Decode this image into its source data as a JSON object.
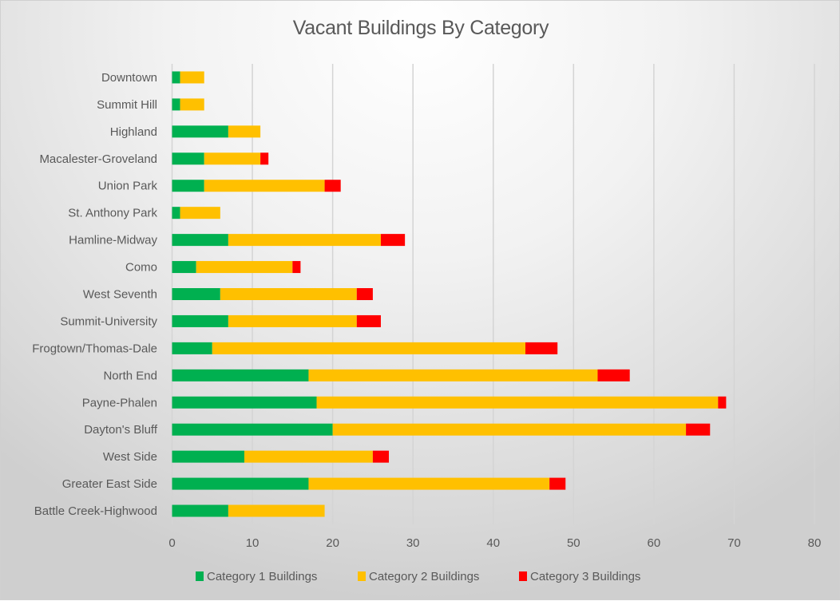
{
  "chart_data": {
    "type": "bar",
    "orientation": "horizontal",
    "stacked": true,
    "title": "Vacant Buildings By Category",
    "xlabel": "",
    "ylabel": "",
    "xlim": [
      0,
      80
    ],
    "xticks": [
      0,
      10,
      20,
      30,
      40,
      50,
      60,
      70,
      80
    ],
    "grid": true,
    "legend_position": "bottom",
    "categories": [
      "Downtown",
      "Summit Hill",
      "Highland",
      "Macalester-Groveland",
      "Union Park",
      "St. Anthony Park",
      "Hamline-Midway",
      "Como",
      "West Seventh",
      "Summit-University",
      "Frogtown/Thomas-Dale",
      "North End",
      "Payne-Phalen",
      "Dayton's Bluff",
      "West Side",
      "Greater East Side",
      "Battle Creek-Highwood"
    ],
    "series": [
      {
        "name": "Category 1 Buildings",
        "color": "#00b050",
        "values": [
          1,
          1,
          7,
          4,
          4,
          1,
          7,
          3,
          6,
          7,
          5,
          17,
          18,
          20,
          9,
          17,
          7
        ]
      },
      {
        "name": "Category 2 Buildings",
        "color": "#ffc000",
        "values": [
          3,
          3,
          4,
          7,
          15,
          5,
          19,
          12,
          17,
          16,
          39,
          36,
          50,
          44,
          16,
          30,
          12
        ]
      },
      {
        "name": "Category 3 Buildings",
        "color": "#ff0000",
        "values": [
          0,
          0,
          0,
          1,
          2,
          0,
          3,
          1,
          2,
          3,
          4,
          4,
          1,
          3,
          2,
          2,
          0
        ]
      }
    ]
  }
}
